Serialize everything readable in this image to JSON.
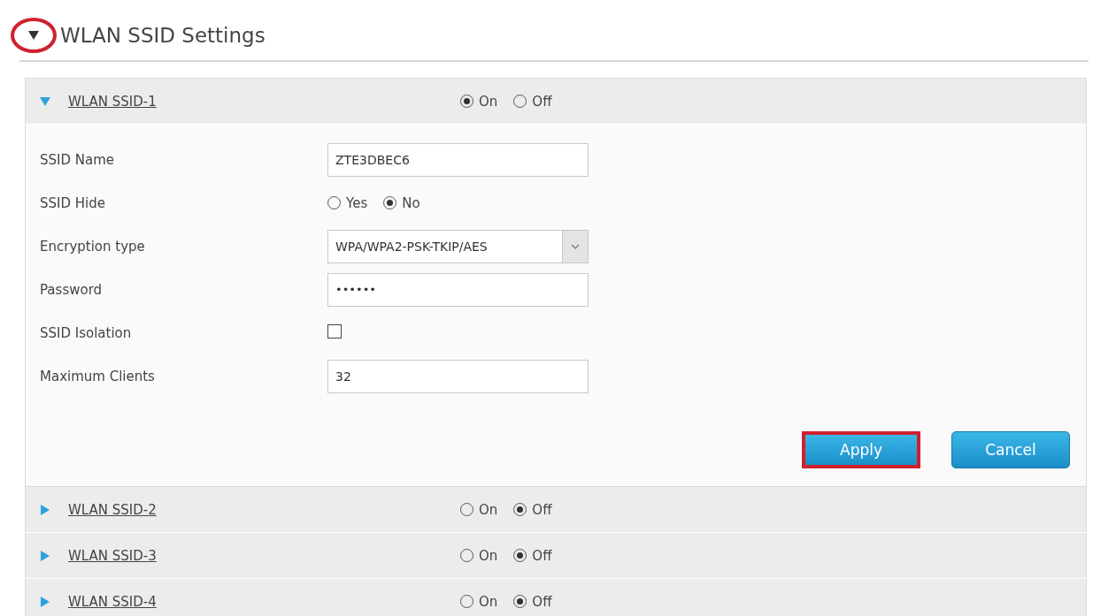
{
  "section": {
    "title": "WLAN SSID Settings",
    "expanded": true,
    "highlighted": true
  },
  "ssids": [
    {
      "name": "WLAN SSID-1",
      "expanded": true,
      "options": [
        {
          "label": "On",
          "selected": true
        },
        {
          "label": "Off",
          "selected": false
        }
      ],
      "fields": [
        {
          "kind": "text",
          "label": "SSID Name",
          "value": "ZTE3DBEC6"
        },
        {
          "kind": "radio",
          "label": "SSID Hide",
          "options": [
            {
              "label": "Yes",
              "selected": false
            },
            {
              "label": "No",
              "selected": true
            }
          ]
        },
        {
          "kind": "select",
          "label": "Encryption type",
          "value": "WPA/WPA2-PSK-TKIP/AES"
        },
        {
          "kind": "password",
          "label": "Password",
          "value": "••••••"
        },
        {
          "kind": "checkbox",
          "label": "SSID Isolation",
          "checked": false
        },
        {
          "kind": "text",
          "label": "Maximum Clients",
          "value": "32"
        }
      ],
      "buttons": [
        {
          "label": "Apply",
          "highlighted": true
        },
        {
          "label": "Cancel",
          "highlighted": false
        }
      ]
    },
    {
      "name": "WLAN SSID-2",
      "expanded": false,
      "options": [
        {
          "label": "On",
          "selected": false
        },
        {
          "label": "Off",
          "selected": true
        }
      ]
    },
    {
      "name": "WLAN SSID-3",
      "expanded": false,
      "options": [
        {
          "label": "On",
          "selected": false
        },
        {
          "label": "Off",
          "selected": true
        }
      ]
    },
    {
      "name": "WLAN SSID-4",
      "expanded": false,
      "options": [
        {
          "label": "On",
          "selected": false
        },
        {
          "label": "Off",
          "selected": true
        }
      ]
    }
  ]
}
